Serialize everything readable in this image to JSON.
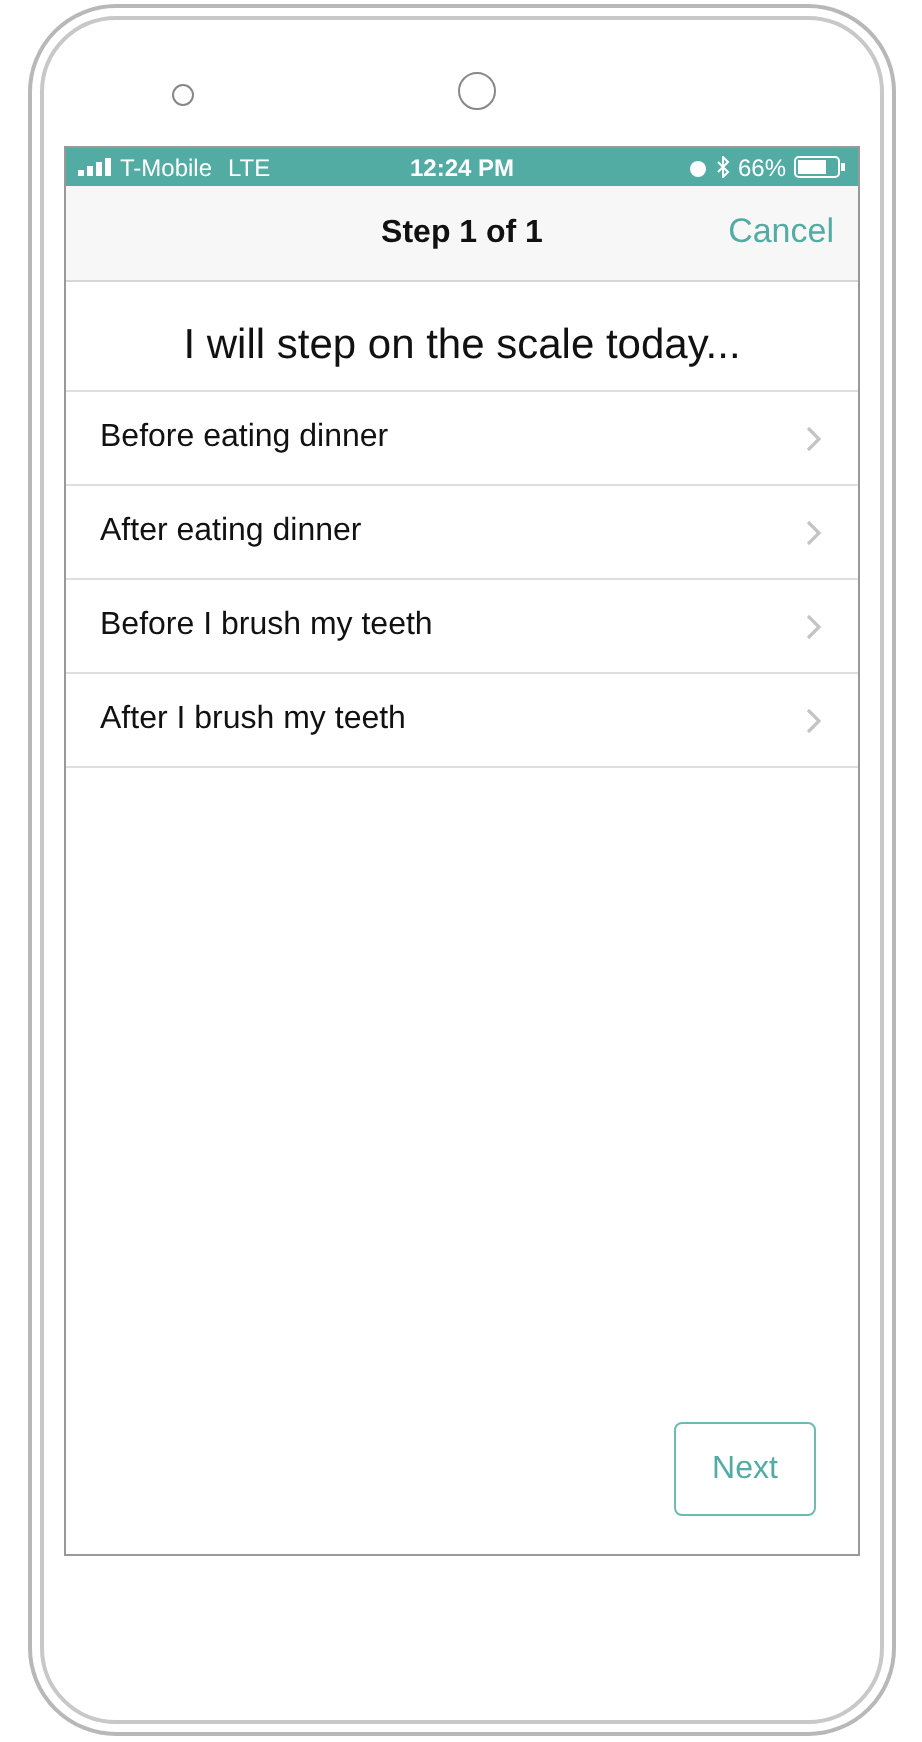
{
  "status_bar": {
    "carrier": "T-Mobile",
    "network": "LTE",
    "time": "12:24 PM",
    "battery": "66%"
  },
  "nav_bar": {
    "title": "Step 1 of 1",
    "action": "Cancel"
  },
  "question": "I will step on the scale today...",
  "options": [
    {
      "label": "Before eating dinner"
    },
    {
      "label": "After eating dinner"
    },
    {
      "label": "Before I brush my teeth"
    },
    {
      "label": "After I brush my teeth"
    }
  ],
  "buttons": [
    "Next"
  ]
}
